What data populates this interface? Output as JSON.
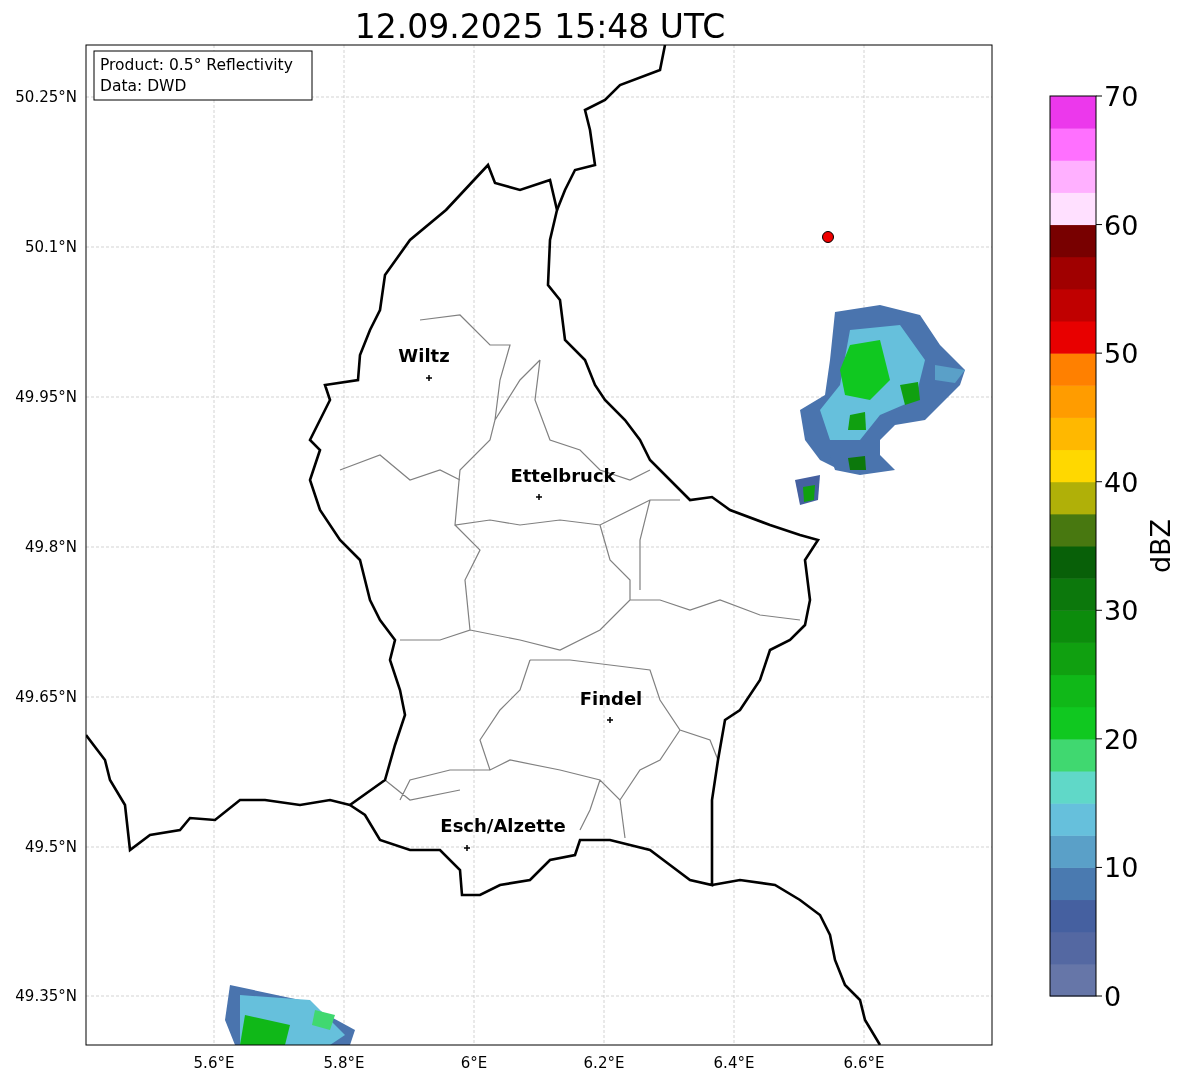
{
  "title": "12.09.2025 15:48 UTC",
  "info_box": {
    "lines": [
      "Product: 0.5° Reflectivity",
      "Data: DWD"
    ]
  },
  "map": {
    "lat_ticks": [
      "50.25°N",
      "50.1°N",
      "49.95°N",
      "49.8°N",
      "49.65°N",
      "49.5°N",
      "49.35°N"
    ],
    "lon_ticks": [
      "5.6°E",
      "5.8°E",
      "6°E",
      "6.2°E",
      "6.4°E",
      "6.6°E"
    ],
    "cities": [
      {
        "name": "Wiltz"
      },
      {
        "name": "Ettelbruck"
      },
      {
        "name": "Findel"
      },
      {
        "name": "Esch/Alzette"
      }
    ]
  },
  "colorbar": {
    "label": "dBZ",
    "ticks": [
      "70",
      "60",
      "50",
      "40",
      "30",
      "20",
      "10",
      "0"
    ],
    "bands": [
      {
        "color": "#6676a8"
      },
      {
        "color": "#5468a2"
      },
      {
        "color": "#4560a0"
      },
      {
        "color": "#4a7ab0"
      },
      {
        "color": "#5aa0c8"
      },
      {
        "color": "#66c0dc"
      },
      {
        "color": "#60d8c8"
      },
      {
        "color": "#40d870"
      },
      {
        "color": "#10c820"
      },
      {
        "color": "#10b818"
      },
      {
        "color": "#10a010"
      },
      {
        "color": "#0c8c0c"
      },
      {
        "color": "#0c780c"
      },
      {
        "color": "#086008"
      },
      {
        "color": "#487810"
      },
      {
        "color": "#b0b008"
      },
      {
        "color": "#ffd800"
      },
      {
        "color": "#ffb800"
      },
      {
        "color": "#ff9c00"
      },
      {
        "color": "#ff8000"
      },
      {
        "color": "#e80000"
      },
      {
        "color": "#c00000"
      },
      {
        "color": "#a00000"
      },
      {
        "color": "#780000"
      },
      {
        "color": "#ffe0ff"
      },
      {
        "color": "#ffb0ff"
      },
      {
        "color": "#ff70ff"
      },
      {
        "color": "#ec38ec"
      }
    ]
  }
}
